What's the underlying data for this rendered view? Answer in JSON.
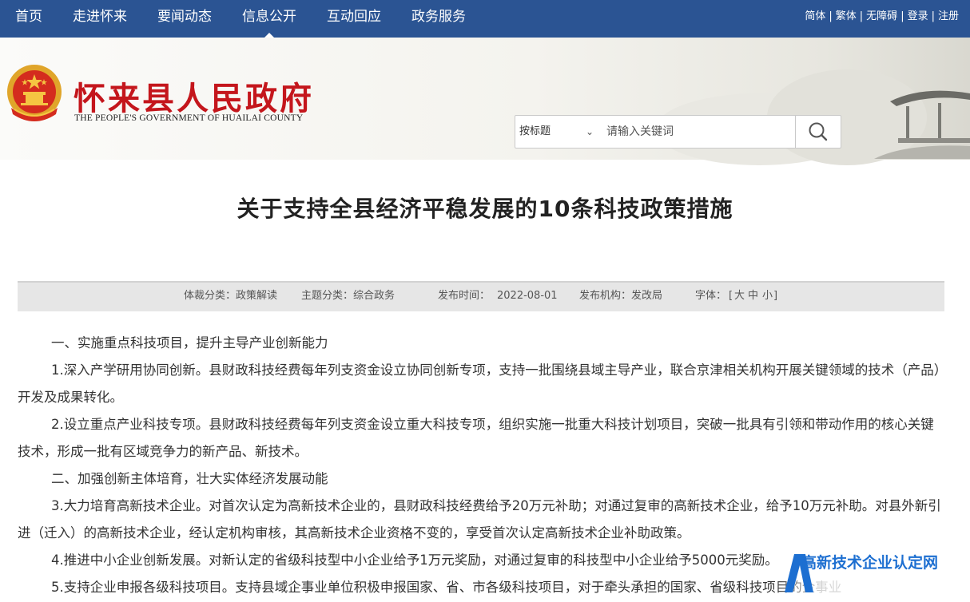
{
  "nav": {
    "items": [
      "首页",
      "走进怀来",
      "要闻动态",
      "信息公开",
      "互动回应",
      "政务服务"
    ],
    "active_index": 3
  },
  "utility": {
    "simplified": "简体",
    "traditional": "繁体",
    "accessible": "无障碍",
    "login": "登录",
    "register": "注册"
  },
  "header": {
    "site_title": "怀来县人民政府",
    "site_subtitle": "THE PEOPLE'S GOVERNMENT OF HUAILAI COUNTY"
  },
  "search": {
    "scope_selected": "按标题",
    "placeholder": "请输入关键词"
  },
  "article": {
    "title": "关于支持全县经济平稳发展的10条科技政策措施",
    "meta": {
      "genre": "体裁分类：政策解读",
      "topic": "主题分类：综合政务",
      "date_label": "发布时间：",
      "date": "2022-08-01",
      "org": "发布机构：发改局",
      "font_label": "字体：",
      "font_open": "[",
      "font_large": "大",
      "font_medium": "中",
      "font_small": "小",
      "font_close": "]"
    },
    "paragraphs": [
      "一、实施重点科技项目，提升主导产业创新能力",
      "1.深入产学研用协同创新。县财政科技经费每年列支资金设立协同创新专项，支持一批围绕县域主导产业，联合京津相关机构开展关键领域的技术（产品）开发及成果转化。",
      "2.设立重点产业科技专项。县财政科技经费每年列支资金设立重大科技专项，组织实施一批重大科技计划项目，突破一批具有引领和带动作用的核心关键技术，形成一批有区域竞争力的新产品、新技术。",
      "二、加强创新主体培育，壮大实体经济发展动能",
      "3.大力培育高新技术企业。对首次认定为高新技术企业的，县财政科技经费给予20万元补助；对通过复审的高新技术企业，给予10万元补助。对县外新引进（迁入）的高新技术企业，经认定机构审核，其高新技术企业资格不变的，享受首次认定高新技术企业补助政策。",
      "4.推进中小企业创新发展。对新认定的省级科技型中小企业给予1万元奖励，对通过复审的科技型中小企业给予5000元奖励。",
      "5.支持企业申报各级科技项目。支持县域企事业单位积极申报国家、省、市各级科技项目，对于牵头承担的国家、省级科技项目的企事业"
    ]
  },
  "watermark": {
    "text": "高新技术企业认定网"
  },
  "colors": {
    "nav_bg": "#2b5493",
    "title_red": "#c4161c",
    "watermark_blue": "#1d6fd1",
    "meta_bg": "#e6e6e6"
  },
  "icons": {
    "search": "magnifier-icon",
    "emblem": "national-emblem-icon",
    "dropdown": "chevron-down-icon"
  }
}
